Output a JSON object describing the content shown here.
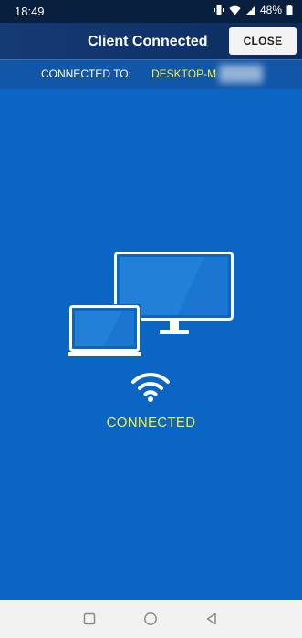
{
  "status_bar": {
    "time": "18:49",
    "battery": "48%",
    "icons": [
      "vibrate-icon",
      "wifi-icon",
      "signal-icon",
      "battery-icon"
    ]
  },
  "header": {
    "title": "Client Connected",
    "close_label": "CLOSE"
  },
  "connection": {
    "label": "CONNECTED TO:",
    "host": "DESKTOP-M"
  },
  "main": {
    "illustration": "laptop-monitor-icon",
    "status_text": "CONNECTED"
  },
  "nav_bar": {
    "icons": [
      "recents-icon",
      "home-icon",
      "back-icon"
    ]
  },
  "colors": {
    "background": "#0b66c3",
    "header": "#0f3268",
    "accent_yellow": "#f4ef3a"
  }
}
